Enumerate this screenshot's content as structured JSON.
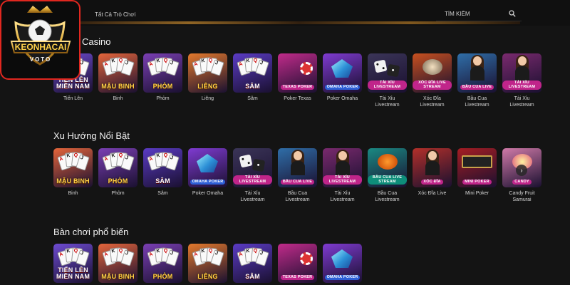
{
  "topbar": {
    "all_games": "Tất Cả Trò Chơi",
    "search_placeholder": "TÌM KIẾM"
  },
  "logo": {
    "name": "KEONHACAI",
    "sub": "VOTO"
  },
  "sections": [
    {
      "title": "Casino",
      "games": [
        {
          "label": "Tiến Lên",
          "brand": "TIẾN LÊN MIỀN NAM",
          "icon": "tien-len-cards",
          "bg": "#6d4bd1"
        },
        {
          "label": "Binh",
          "brand": "MẬU BINH",
          "icon": "mau-binh-cards",
          "bg": "#e4653b"
        },
        {
          "label": "Phỏm",
          "brand": "PHỎM",
          "icon": "phom-cards",
          "bg": "#7a3fb3"
        },
        {
          "label": "Liêng",
          "brand": "LIÊNG",
          "icon": "lieng-cards",
          "bg": "#e3792c"
        },
        {
          "label": "Sâm",
          "brand": "SÂM",
          "icon": "sam-cards",
          "bg": "#5a3bc4"
        },
        {
          "label": "Poker Texas",
          "brand": "TEXAS POKER",
          "icon": "texas-poker-chip",
          "bg": "#c12b8a"
        },
        {
          "label": "Poker Omaha",
          "brand": "OMAHA POKER",
          "icon": "omaha-gem",
          "bg": "#7f3bd1"
        },
        {
          "label": "Tài Xỉu Livestream",
          "brand": "TÀI XỈU LIVESTREAM",
          "icon": "tai-xiu-dice",
          "bg": "#3b3558"
        },
        {
          "label": "Xóc Đĩa Livestream",
          "brand": "XÓC ĐĨA LIVE STREAM",
          "icon": "xoc-dia-bowl",
          "bg": "#c7501f"
        },
        {
          "label": "Bầu Cua Livestream",
          "brand": "BẦU CUA LIVE",
          "icon": "bau-cua-dealer",
          "bg": "#2f6ea8"
        },
        {
          "label": "Tài Xỉu Livestream",
          "brand": "TÀI XỈU LIVESTREAM",
          "icon": "tai-xiu-dealer",
          "bg": "#7a2a6e"
        }
      ]
    },
    {
      "title": "Xu Hướng Nổi Bật",
      "games": [
        {
          "label": "Binh",
          "brand": "MẬU BINH",
          "icon": "mau-binh-cards",
          "bg": "#e4653b"
        },
        {
          "label": "Phỏm",
          "brand": "PHỎM",
          "icon": "phom-cards",
          "bg": "#7a3fb3"
        },
        {
          "label": "Sâm",
          "brand": "SÂM",
          "icon": "sam-cards",
          "bg": "#5a3bc4"
        },
        {
          "label": "Poker Omaha",
          "brand": "OMAHA POKER",
          "icon": "omaha-gem",
          "bg": "#7f3bd1"
        },
        {
          "label": "Tài Xỉu Livestream",
          "brand": "TÀI XỈU LIVESTREAM",
          "icon": "tai-xiu-dice",
          "bg": "#3b3558"
        },
        {
          "label": "Bầu Cua Livestream",
          "brand": "BẦU CUA LIVE",
          "icon": "bau-cua-dealer",
          "bg": "#2f6ea8"
        },
        {
          "label": "Tài Xỉu Livestream",
          "brand": "TÀI XỈU LIVESTREAM",
          "icon": "tai-xiu-dealer",
          "bg": "#7a2a6e"
        },
        {
          "label": "Bầu Cua Livestream",
          "brand": "BẦU CUA LIVE STREAM",
          "icon": "bau-cua-crab",
          "bg": "#1a8a83"
        },
        {
          "label": "Xóc Đĩa Live",
          "brand": "XÓC ĐĨA",
          "icon": "xoc-dia-dealer",
          "bg": "#b3302a"
        },
        {
          "label": "Mini Poker",
          "brand": "MINI POKER",
          "icon": "mini-poker-slot",
          "bg": "#a51d23"
        },
        {
          "label": "Candy Fruit Samurai",
          "brand": "CANDY",
          "icon": "candy-fruit",
          "bg": "#d07aa8"
        }
      ]
    },
    {
      "title": "Bàn chơi phổ biến",
      "games": [
        {
          "label": "",
          "brand": "TIẾN LÊN MIỀN NAM",
          "icon": "tien-len-cards",
          "bg": "#6d4bd1"
        },
        {
          "label": "",
          "brand": "MẬU BINH",
          "icon": "mau-binh-cards",
          "bg": "#e4653b"
        },
        {
          "label": "",
          "brand": "PHỎM",
          "icon": "phom-cards",
          "bg": "#7a3fb3"
        },
        {
          "label": "",
          "brand": "LIÊNG",
          "icon": "lieng-cards",
          "bg": "#e3792c"
        },
        {
          "label": "",
          "brand": "SÂM",
          "icon": "sam-cards",
          "bg": "#5a3bc4"
        },
        {
          "label": "",
          "brand": "TEXAS POKER",
          "icon": "texas-poker-chip",
          "bg": "#c12b8a"
        },
        {
          "label": "",
          "brand": "OMAHA POKER",
          "icon": "omaha-gem",
          "bg": "#7f3bd1"
        }
      ]
    }
  ],
  "next_arrow_icon": "chevron-right-icon"
}
